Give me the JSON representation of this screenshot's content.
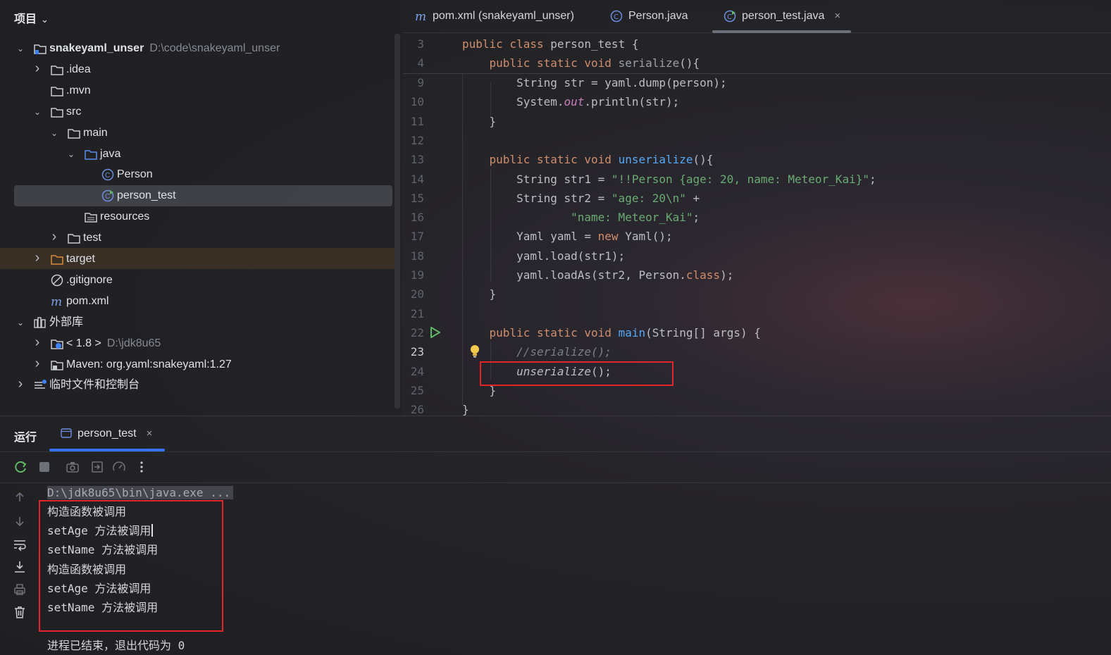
{
  "project_panel": {
    "title": "项目",
    "tree": [
      {
        "label": "snakeyaml_unser",
        "hint": "D:\\code\\snakeyaml_unser",
        "icon": "module-folder-icon"
      },
      {
        "label": ".idea",
        "icon": "folder-icon"
      },
      {
        "label": ".mvn",
        "icon": "folder-icon"
      },
      {
        "label": "src",
        "icon": "folder-icon"
      },
      {
        "label": "main",
        "icon": "folder-icon"
      },
      {
        "label": "java",
        "icon": "source-folder-icon"
      },
      {
        "label": "Person",
        "icon": "class-icon"
      },
      {
        "label": "person_test",
        "icon": "runnable-class-icon"
      },
      {
        "label": "resources",
        "icon": "resources-folder-icon"
      },
      {
        "label": "test",
        "icon": "folder-icon"
      },
      {
        "label": "target",
        "icon": "excluded-folder-icon"
      },
      {
        "label": ".gitignore",
        "icon": "ignore-file-icon"
      },
      {
        "label": "pom.xml",
        "icon": "maven-icon"
      },
      {
        "label": "外部库",
        "icon": "library-icon"
      },
      {
        "label": "< 1.8 >",
        "hint": "D:\\jdk8u65",
        "icon": "jdk-icon"
      },
      {
        "label": "Maven: org.yaml:snakeyaml:1.27",
        "icon": "library-jar-icon"
      },
      {
        "label": "临时文件和控制台",
        "icon": "scratches-icon"
      }
    ]
  },
  "editor": {
    "tabs": [
      {
        "label": "pom.xml (snakeyaml_unser)",
        "icon": "maven-icon"
      },
      {
        "label": "Person.java",
        "icon": "class-icon"
      },
      {
        "label": "person_test.java",
        "icon": "runnable-class-icon",
        "active": true,
        "close": "×"
      }
    ],
    "line_numbers": [
      "3",
      "4",
      "9",
      "10",
      "11",
      "12",
      "13",
      "14",
      "15",
      "16",
      "17",
      "18",
      "19",
      "20",
      "21",
      "22",
      "23",
      "24",
      "25",
      "26"
    ],
    "lines": [
      [
        [
          "kw",
          "public class "
        ],
        [
          "",
          "person_test {"
        ]
      ],
      [
        [
          "",
          "    "
        ],
        [
          "kw",
          "public static void "
        ],
        [
          "cmt-plain",
          "serialize"
        ],
        [
          "",
          "(){"
        ]
      ],
      [
        [
          "",
          "        String str = yaml.dump(person);"
        ]
      ],
      [
        [
          "",
          "        System."
        ],
        [
          "field",
          "out"
        ],
        [
          "",
          ".println(str);"
        ]
      ],
      [
        [
          "",
          "    }"
        ]
      ],
      [
        [
          "",
          ""
        ]
      ],
      [
        [
          "",
          "    "
        ],
        [
          "kw",
          "public static void "
        ],
        [
          "fn",
          "unserialize"
        ],
        [
          "",
          "(){"
        ]
      ],
      [
        [
          "",
          "        String str1 = "
        ],
        [
          "str",
          "\"!!Person {age: 20, name: Meteor_Kai}\""
        ],
        [
          "",
          ";"
        ]
      ],
      [
        [
          "",
          "        String str2 = "
        ],
        [
          "str",
          "\"age: 20\\n\""
        ],
        [
          "",
          " +"
        ]
      ],
      [
        [
          "",
          "                "
        ],
        [
          "str",
          "\"name: Meteor_Kai\""
        ],
        [
          "",
          ";"
        ]
      ],
      [
        [
          "",
          "        Yaml yaml = "
        ],
        [
          "kw",
          "new "
        ],
        [
          "",
          "Yaml();"
        ]
      ],
      [
        [
          "",
          "        yaml.load(str1);"
        ]
      ],
      [
        [
          "",
          "        yaml.loadAs(str2, Person."
        ],
        [
          "kw",
          "class"
        ],
        [
          "",
          ");"
        ]
      ],
      [
        [
          "",
          "    }"
        ]
      ],
      [
        [
          "",
          ""
        ]
      ],
      [
        [
          "",
          "    "
        ],
        [
          "kw",
          "public static void "
        ],
        [
          "fn",
          "main"
        ],
        [
          "",
          "(String[] args) {"
        ]
      ],
      [
        [
          "",
          "        "
        ],
        [
          "cmt",
          "//serialize();"
        ]
      ],
      [
        [
          "",
          "        "
        ],
        [
          "ital",
          "unserialize"
        ],
        [
          "",
          "();"
        ]
      ],
      [
        [
          "",
          "    }"
        ]
      ],
      [
        [
          "",
          "}"
        ]
      ]
    ]
  },
  "run": {
    "title": "运行",
    "tab_label": "person_test",
    "tab_close": "×",
    "console": [
      "D:\\jdk8u65\\bin\\java.exe ...",
      "构造函数被调用",
      "setAge 方法被调用",
      "setName 方法被调用",
      "构造函数被调用",
      "setAge 方法被调用",
      "setName 方法被调用",
      "",
      "进程已结束，退出代码为 0"
    ]
  },
  "colors": {
    "accent": "#3574f0",
    "highlight_box": "#e0262b",
    "keyword": "#cf8e6d",
    "function": "#56a8f5",
    "string": "#6aab73"
  }
}
